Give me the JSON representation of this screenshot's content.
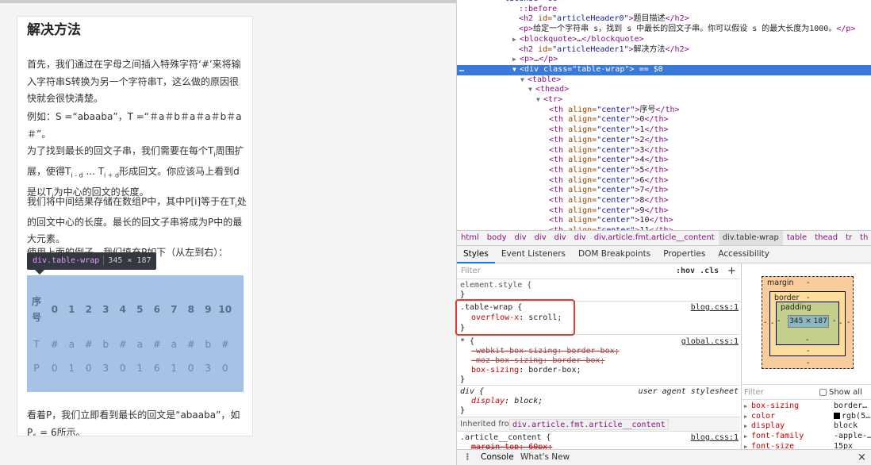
{
  "article": {
    "title": "解决方法",
    "p1": "首先，我们通过在字母之间插入特殊字符‘#’来将输入字符串S转换为另一个字符串T，这么做的原因很快就会很快清楚。",
    "p2": "例如：S =“abaaba”，T =“＃a＃b＃a＃a＃b＃a＃”。",
    "p3a": "为了找到最长的回文子串，我们需要在每个T",
    "p3b": "周围扩展，使得T",
    "p3c": " ... T",
    "p3d": "形成回文。你应该马上看到d是以T",
    "p3e": "为中心的回文的长度。",
    "sub_i": "i",
    "sub_imd": "i - d",
    "sub_ipd": "i + d",
    "p4a": "我们将中间结果存储在数组P中，其中P[i]等于在T",
    "p4b": "处的回文中心的长度。最长的回文子串将成为P中的最大元素。",
    "p5": "使用上面的例子，我们填充P如下（从左到右）：",
    "p6a": "看着P，我们立即看到最长的回文是“abaaba”，如P",
    "p6sub": "6",
    "p6b": " = 6所示。",
    "table": {
      "header": [
        "序号",
        "0",
        "1",
        "2",
        "3",
        "4",
        "5",
        "6",
        "7",
        "8",
        "9",
        "10"
      ],
      "rows": [
        [
          "T",
          "#",
          "a",
          "#",
          "b",
          "#",
          "a",
          "#",
          "a",
          "#",
          "b",
          "#"
        ],
        [
          "P",
          "0",
          "1",
          "0",
          "3",
          "0",
          "1",
          "6",
          "1",
          "0",
          "3",
          "0"
        ]
      ]
    }
  },
  "tooltip": {
    "name": "div.table-wrap",
    "size": "345 × 187"
  },
  "dom_tree": [
    {
      "text": "license=\"cc\">",
      "cls": "av",
      "indent": 60
    },
    {
      "text": "::before",
      "cls": "tg",
      "indent": 78
    },
    {
      "text": "<h2 id=\"articleHeader0\">题目描述</h2>",
      "cls": "mix",
      "indent": 78
    },
    {
      "text": "<p>给定一个字符串 s，找到 s 中最长的回文子串。你可以假设 s 的最大长度为1000。</p>",
      "cls": "mix",
      "indent": 78
    },
    {
      "text": "<blockquote>…</blockquote>",
      "cls": "mix",
      "indent": 70,
      "tri": "▶"
    },
    {
      "text": "<h2 id=\"articleHeader1\">解决方法</h2>",
      "cls": "mix",
      "indent": 78
    },
    {
      "text": "<p>…</p>",
      "cls": "mix",
      "indent": 70,
      "tri": "▶"
    },
    {
      "text": "<div class=\"table-wrap\"> == $0",
      "cls": "mix",
      "indent": 70,
      "tri": "▼",
      "selected": true
    },
    {
      "text": "<table>",
      "cls": "mix",
      "indent": 80,
      "tri": "▼"
    },
    {
      "text": "<thead>",
      "cls": "mix",
      "indent": 90,
      "tri": "▼"
    },
    {
      "text": "<tr>",
      "cls": "mix",
      "indent": 100,
      "tri": "▼"
    },
    {
      "text": "<th align=\"center\">序号</th>",
      "cls": "mix",
      "indent": 116
    },
    {
      "text": "<th align=\"center\">0</th>",
      "cls": "mix",
      "indent": 116
    },
    {
      "text": "<th align=\"center\">1</th>",
      "cls": "mix",
      "indent": 116
    },
    {
      "text": "<th align=\"center\">2</th>",
      "cls": "mix",
      "indent": 116
    },
    {
      "text": "<th align=\"center\">3</th>",
      "cls": "mix",
      "indent": 116
    },
    {
      "text": "<th align=\"center\">4</th>",
      "cls": "mix",
      "indent": 116
    },
    {
      "text": "<th align=\"center\">5</th>",
      "cls": "mix",
      "indent": 116
    },
    {
      "text": "<th align=\"center\">6</th>",
      "cls": "mix",
      "indent": 116
    },
    {
      "text": "<th align=\"center\">7</th>",
      "cls": "mix",
      "indent": 116
    },
    {
      "text": "<th align=\"center\">8</th>",
      "cls": "mix",
      "indent": 116
    },
    {
      "text": "<th align=\"center\">9</th>",
      "cls": "mix",
      "indent": 116
    },
    {
      "text": "<th align=\"center\">10</th>",
      "cls": "mix",
      "indent": 116
    },
    {
      "text": "<th align=\"center\">11</th>",
      "cls": "mix",
      "indent": 116
    }
  ],
  "breadcrumbs": [
    "html",
    "body",
    "div",
    "div",
    "div",
    "div",
    "div.article.fmt.article__content",
    "div.table-wrap",
    "table",
    "thead",
    "tr",
    "th"
  ],
  "tabs": [
    "Styles",
    "Event Listeners",
    "DOM Breakpoints",
    "Properties",
    "Accessibility"
  ],
  "styles": {
    "filter_placeholder": "Filter",
    "hov": ":hov",
    "cls": ".cls",
    "plus": "+",
    "element_style": "element.style {",
    "close": "}",
    "rule1_selector": ".table-wrap {",
    "rule1_source": "blog.css:1",
    "rule1_prop": "overflow-x",
    "rule1_val": "scroll;",
    "rule2_selector": "* {",
    "rule2_source": "global.css:1",
    "rule2_p1": "-webkit-box-sizing: border-box;",
    "rule2_p2": "-moz-box-sizing: border-box;",
    "rule2_p3_prop": "box-sizing",
    "rule2_p3_val": "border-box;",
    "rule3_selector": "div {",
    "rule3_source": "user agent stylesheet",
    "rule3_prop": "display",
    "rule3_val": "block;",
    "inherited_label": "Inherited from",
    "inherited_class": "div.article.fmt.article__content",
    "rule4_selector": ".article__content {",
    "rule4_source": "blog.css:1",
    "rule4_cut": "margin-top: 60px;"
  },
  "box_model": {
    "margin_label": "margin",
    "border_label": "border",
    "padding_label": "padding",
    "dash": "-",
    "content_size": "345 × 187"
  },
  "computed": {
    "filter_placeholder": "Filter",
    "show_all": "Show all",
    "items": [
      {
        "name": "box-sizing",
        "value": "border…"
      },
      {
        "name": "color",
        "value": "rgb(5…"
      },
      {
        "name": "display",
        "value": "block"
      },
      {
        "name": "font-family",
        "value": "-apple-…"
      },
      {
        "name": "font-size",
        "value": "15px"
      }
    ]
  },
  "drawer": {
    "menu": "⋮",
    "console": "Console",
    "whats_new": "What's New",
    "close": "×"
  }
}
